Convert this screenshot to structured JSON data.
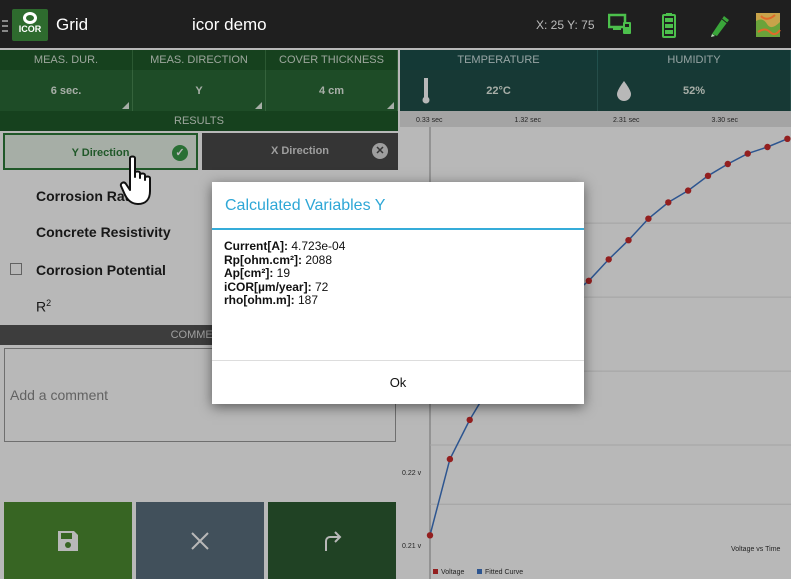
{
  "topbar": {
    "app_title": "Grid",
    "center_title": "icor demo",
    "coords": "X: 25 Y: 75",
    "logo_text": "ICOR",
    "icons": [
      "pc-connect-icon",
      "battery-icon",
      "pen-icon",
      "map-icon"
    ]
  },
  "settings": [
    {
      "header": "MEAS. DUR.",
      "value": "6 sec."
    },
    {
      "header": "MEAS. DIRECTION",
      "value": "Y"
    },
    {
      "header": "COVER THICKNESS",
      "value": "4 cm"
    }
  ],
  "environment": [
    {
      "header": "TEMPERATURE",
      "value": "22°C",
      "icon": "thermometer-icon"
    },
    {
      "header": "HUMIDITY",
      "value": "52%",
      "icon": "drop-icon"
    }
  ],
  "results": {
    "header": "RESULTS",
    "tab_y": "Y Direction",
    "tab_x": "X Direction",
    "rows": [
      "Corrosion Rate",
      "Concrete Resistivity",
      "Corrosion Potential"
    ],
    "r_squared_label": "R",
    "r_squared_sup": "2"
  },
  "comment": {
    "header": "COMMENT",
    "placeholder": "Add a comment"
  },
  "actions": [
    "save-icon",
    "close-icon",
    "redo-icon"
  ],
  "modal": {
    "title": "Calculated Variables Y",
    "variables": [
      {
        "name": "Current[A]:",
        "value": " 4.723e-04"
      },
      {
        "name": "Rp[ohm.cm²]:",
        "value": " 2088"
      },
      {
        "name": "Ap[cm²]:",
        "value": " 19"
      },
      {
        "name": "iCOR[µm/year]:",
        "value": " 72"
      },
      {
        "name": "rho[ohm.m]:",
        "value": " 187"
      }
    ],
    "ok_label": "Ok"
  },
  "colors": {
    "green_dark": "#1f5a2a",
    "teal_dark": "#1d4f4c",
    "accent_blue": "#2ea7d6",
    "voltage_red": "#cc2b2b",
    "fitted_blue": "#3f77c8"
  },
  "chart_data": {
    "type": "line",
    "xlabel_top_ticks": [
      "0.33 sec",
      "1.32 sec",
      "2.31 sec",
      "3.30 sec",
      "4.29 sec",
      "5.28 sec"
    ],
    "y_ticks": [
      "0.22 v",
      "0.21 v"
    ],
    "corner_label": "Voltage vs Time",
    "legend": [
      "Voltage",
      "Fitted Curve"
    ],
    "series": [
      {
        "name": "Voltage",
        "x": [
          0.0,
          0.33,
          0.66,
          0.99,
          1.32,
          1.65,
          1.98,
          2.31,
          2.64,
          2.97,
          3.3,
          3.63,
          3.96,
          4.29,
          4.62,
          4.95,
          5.28,
          5.61,
          5.94
        ],
        "y": [
          0.2098,
          0.2201,
          0.2254,
          0.2299,
          0.2339,
          0.237,
          0.2396,
          0.242,
          0.2442,
          0.2471,
          0.2497,
          0.2526,
          0.2548,
          0.2564,
          0.2584,
          0.26,
          0.2614,
          0.2623,
          0.2634
        ]
      },
      {
        "name": "Fitted Curve",
        "x": [
          0.0,
          0.33,
          0.66,
          0.99,
          1.32,
          1.65,
          1.98,
          2.31,
          2.64,
          2.97,
          3.3,
          3.63,
          3.96,
          4.29,
          4.62,
          4.95,
          5.28,
          5.61,
          5.94
        ],
        "y": [
          0.2098,
          0.2201,
          0.2254,
          0.2299,
          0.2339,
          0.237,
          0.2396,
          0.242,
          0.2442,
          0.2471,
          0.2497,
          0.2526,
          0.2548,
          0.2564,
          0.2584,
          0.26,
          0.2614,
          0.2623,
          0.2634
        ]
      }
    ],
    "xlim": [
      0.0,
      6.0
    ],
    "ylim": [
      0.207,
      0.265
    ]
  }
}
